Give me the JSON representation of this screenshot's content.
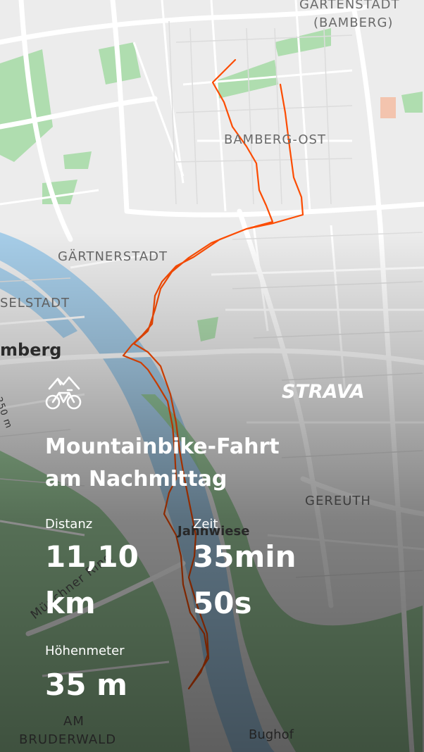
{
  "map": {
    "labels": {
      "gartenstadt_1": "GARTENSTADT",
      "gartenstadt_2": "(BAMBERG)",
      "bamberg_ost": "BAMBERG-OST",
      "gaertnerstadt": "GÄRTNERSTADT",
      "inselstadt": "SELSTADT",
      "bamberg": "mberg",
      "gereuth": "GEREUTH",
      "jahnwiese": "Jahnwiese",
      "muenchner_ring": "Münchner Ring",
      "road_250": "250 m",
      "am": "AM",
      "bruderwald": "BRUDERWALD",
      "bughof": "Bughof"
    },
    "colors": {
      "background": "#ececec",
      "park": "#8fd18f",
      "water": "#9fc8e8",
      "route": "#fc4c02"
    }
  },
  "activity": {
    "icon": "mountain-bike-icon",
    "brand": "STRAVA",
    "title_line1": "Mountainbike-Fahrt",
    "title_line2": "am Nachmittag",
    "stats": {
      "distance_label": "Distanz",
      "distance_value_1": "11,10",
      "distance_value_2": "km",
      "time_label": "Zeit",
      "time_value_1": "35min",
      "time_value_2": "50s",
      "elevation_label": "Höhenmeter",
      "elevation_value": "35 m"
    }
  }
}
